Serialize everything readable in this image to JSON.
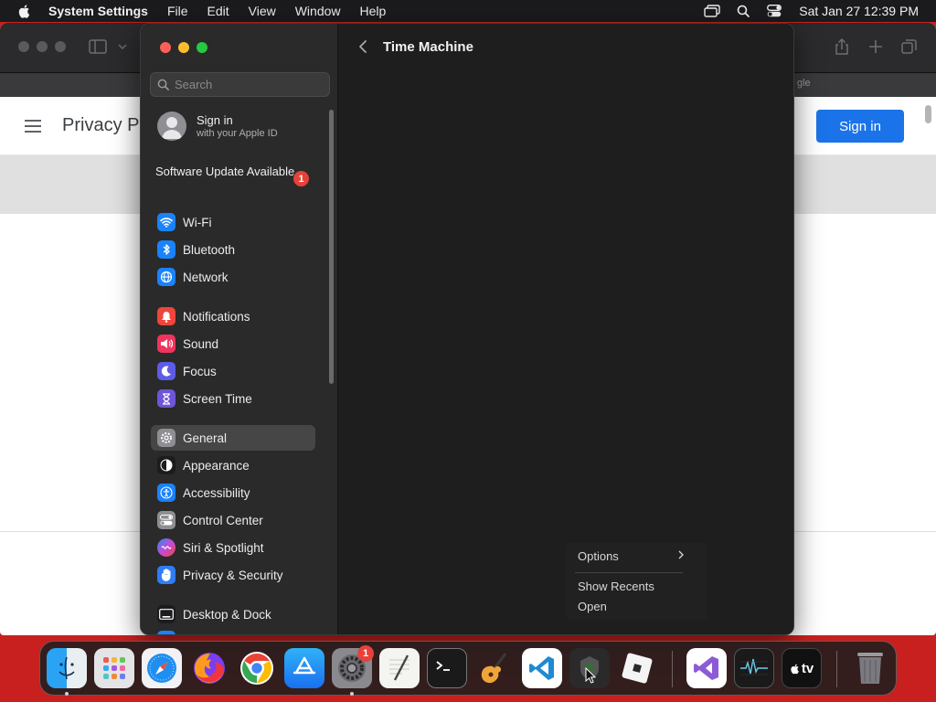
{
  "menubar": {
    "app_name": "System Settings",
    "menus": [
      "File",
      "Edit",
      "View",
      "Window",
      "Help"
    ],
    "clock": "Sat Jan 27  12:39 PM"
  },
  "browser": {
    "tab_text": "gle",
    "page_title": "Privacy Pc",
    "signin_label": "Sign in"
  },
  "settings": {
    "search_placeholder": "Search",
    "account": {
      "title": "Sign in",
      "subtitle": "with your Apple ID"
    },
    "software_update": {
      "label": "Software Update Available",
      "badge": "1"
    },
    "sidebar_items": [
      {
        "label": "Wi-Fi",
        "color": "#1a82fb"
      },
      {
        "label": "Bluetooth",
        "color": "#1a82fb"
      },
      {
        "label": "Network",
        "color": "#1a82fb"
      },
      {
        "label": "Notifications",
        "color": "#f0453a"
      },
      {
        "label": "Sound",
        "color": "#f0345d"
      },
      {
        "label": "Focus",
        "color": "#5e5ce6"
      },
      {
        "label": "Screen Time",
        "color": "#6e55d8"
      },
      {
        "label": "General",
        "color": "#8e8e93",
        "selected": true
      },
      {
        "label": "Appearance",
        "color": "#1c1c1e"
      },
      {
        "label": "Accessibility",
        "color": "#1a82fb"
      },
      {
        "label": "Control Center",
        "color": "#8e8e93"
      },
      {
        "label": "Siri & Spotlight",
        "color": "#c54bd8"
      },
      {
        "label": "Privacy & Security",
        "color": "#2f7cf6"
      },
      {
        "label": "Desktop & Dock",
        "color": "#1c1c1e"
      }
    ],
    "content_title": "Time Machine"
  },
  "context_menu": {
    "options": "Options",
    "show_recents": "Show Recents",
    "open": "Open"
  },
  "dock": {
    "tv_label": "tv",
    "settings_badge": "1",
    "apps": [
      "Finder",
      "Launchpad",
      "Safari",
      "Firefox",
      "Chrome",
      "App Store",
      "System Settings",
      "TextEdit",
      "Terminal",
      "GarageBand",
      "Visual Studio Code",
      "Unknown",
      "Roblox",
      "Visual Studio",
      "Activity Monitor",
      "Apple TV",
      "Trash"
    ]
  }
}
